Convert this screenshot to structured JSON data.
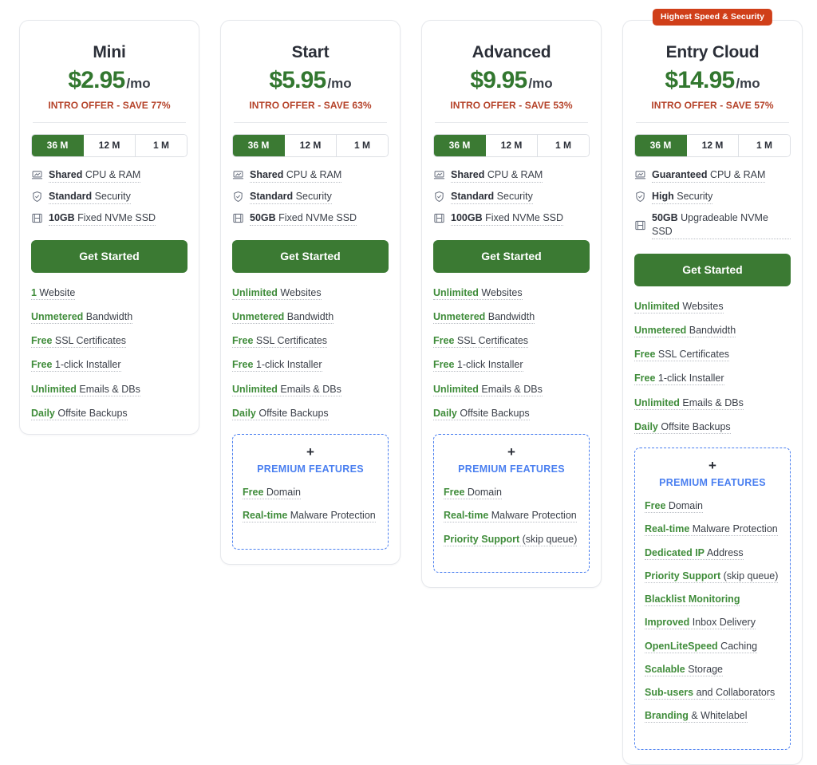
{
  "colors": {
    "price_green": "#32772f",
    "cta_green": "#3b7a33",
    "offer_red": "#b5432a",
    "badge_red": "#d03f19",
    "premium_blue": "#4a7ff0",
    "feature_green": "#3f8c3a",
    "card_border": "#e6e8ec"
  },
  "premium": {
    "plus": "+",
    "title": "PREMIUM FEATURES"
  },
  "plans": [
    {
      "name": "Mini",
      "price": "$2.95",
      "period": "/mo",
      "offer": "INTRO OFFER - SAVE 77%",
      "badge": null,
      "terms": [
        {
          "label": "36 M",
          "active": true
        },
        {
          "label": "12 M",
          "active": false
        },
        {
          "label": "1 M",
          "active": false
        }
      ],
      "specs": [
        {
          "icon": "cpu-icon",
          "strong": "Shared",
          "rest": " CPU & RAM"
        },
        {
          "icon": "shield-icon",
          "strong": "Standard",
          "rest": " Security"
        },
        {
          "icon": "storage-icon",
          "strong": "10GB",
          "rest": " Fixed NVMe SSD"
        }
      ],
      "cta": "Get Started",
      "features": [
        {
          "strong": "1",
          "rest": " Website"
        },
        {
          "strong": "Unmetered",
          "rest": " Bandwidth"
        },
        {
          "strong": "Free",
          "rest": " SSL Certificates"
        },
        {
          "strong": "Free",
          "rest": " 1-click Installer"
        },
        {
          "strong": "Unlimited",
          "rest": " Emails & DBs"
        },
        {
          "strong": "Daily",
          "rest": " Offsite Backups"
        }
      ],
      "premium_features": []
    },
    {
      "name": "Start",
      "price": "$5.95",
      "period": "/mo",
      "offer": "INTRO OFFER - SAVE 63%",
      "badge": null,
      "terms": [
        {
          "label": "36 M",
          "active": true
        },
        {
          "label": "12 M",
          "active": false
        },
        {
          "label": "1 M",
          "active": false
        }
      ],
      "specs": [
        {
          "icon": "cpu-icon",
          "strong": "Shared",
          "rest": " CPU & RAM"
        },
        {
          "icon": "shield-icon",
          "strong": "Standard",
          "rest": " Security"
        },
        {
          "icon": "storage-icon",
          "strong": "50GB",
          "rest": " Fixed NVMe SSD"
        }
      ],
      "cta": "Get Started",
      "features": [
        {
          "strong": "Unlimited",
          "rest": " Websites"
        },
        {
          "strong": "Unmetered",
          "rest": " Bandwidth"
        },
        {
          "strong": "Free",
          "rest": " SSL Certificates"
        },
        {
          "strong": "Free",
          "rest": " 1-click Installer"
        },
        {
          "strong": "Unlimited",
          "rest": " Emails & DBs"
        },
        {
          "strong": "Daily",
          "rest": " Offsite Backups"
        }
      ],
      "premium_features": [
        {
          "strong": "Free",
          "rest": " Domain"
        },
        {
          "strong": "Real-time",
          "rest": " Malware Protection"
        }
      ]
    },
    {
      "name": "Advanced",
      "price": "$9.95",
      "period": "/mo",
      "offer": "INTRO OFFER - SAVE 53%",
      "badge": null,
      "terms": [
        {
          "label": "36 M",
          "active": true
        },
        {
          "label": "12 M",
          "active": false
        },
        {
          "label": "1 M",
          "active": false
        }
      ],
      "specs": [
        {
          "icon": "cpu-icon",
          "strong": "Shared",
          "rest": " CPU & RAM"
        },
        {
          "icon": "shield-icon",
          "strong": "Standard",
          "rest": " Security"
        },
        {
          "icon": "storage-icon",
          "strong": "100GB",
          "rest": " Fixed NVMe SSD"
        }
      ],
      "cta": "Get Started",
      "features": [
        {
          "strong": "Unlimited",
          "rest": " Websites"
        },
        {
          "strong": "Unmetered",
          "rest": " Bandwidth"
        },
        {
          "strong": "Free",
          "rest": " SSL Certificates"
        },
        {
          "strong": "Free",
          "rest": " 1-click Installer"
        },
        {
          "strong": "Unlimited",
          "rest": " Emails & DBs"
        },
        {
          "strong": "Daily",
          "rest": " Offsite Backups"
        }
      ],
      "premium_features": [
        {
          "strong": "Free",
          "rest": " Domain"
        },
        {
          "strong": "Real-time",
          "rest": " Malware Protection"
        },
        {
          "strong": "Priority Support",
          "rest": " (skip queue)"
        }
      ]
    },
    {
      "name": "Entry Cloud",
      "price": "$14.95",
      "period": "/mo",
      "offer": "INTRO OFFER - SAVE 57%",
      "badge": "Highest Speed & Security",
      "terms": [
        {
          "label": "36 M",
          "active": true
        },
        {
          "label": "12 M",
          "active": false
        },
        {
          "label": "1 M",
          "active": false
        }
      ],
      "specs": [
        {
          "icon": "cpu-icon",
          "strong": "Guaranteed",
          "rest": " CPU & RAM"
        },
        {
          "icon": "shield-icon",
          "strong": "High",
          "rest": " Security"
        },
        {
          "icon": "storage-icon",
          "strong": "50GB",
          "rest": " Upgradeable NVMe SSD"
        }
      ],
      "cta": "Get Started",
      "features": [
        {
          "strong": "Unlimited",
          "rest": " Websites"
        },
        {
          "strong": "Unmetered",
          "rest": " Bandwidth"
        },
        {
          "strong": "Free",
          "rest": " SSL Certificates"
        },
        {
          "strong": "Free",
          "rest": " 1-click Installer"
        },
        {
          "strong": "Unlimited",
          "rest": " Emails & DBs"
        },
        {
          "strong": "Daily",
          "rest": " Offsite Backups"
        }
      ],
      "premium_features": [
        {
          "strong": "Free",
          "rest": " Domain"
        },
        {
          "strong": "Real-time",
          "rest": " Malware Protection"
        },
        {
          "strong": "Dedicated IP",
          "rest": " Address"
        },
        {
          "strong": "Priority Support",
          "rest": " (skip queue)"
        },
        {
          "strong": "Blacklist Monitoring",
          "rest": ""
        },
        {
          "strong": "Improved",
          "rest": " Inbox Delivery"
        },
        {
          "strong": "OpenLiteSpeed",
          "rest": " Caching"
        },
        {
          "strong": "Scalable",
          "rest": " Storage"
        },
        {
          "strong": "Sub-users",
          "rest": " and Collaborators"
        },
        {
          "strong": "Branding",
          "rest": " & Whitelabel"
        }
      ]
    }
  ]
}
